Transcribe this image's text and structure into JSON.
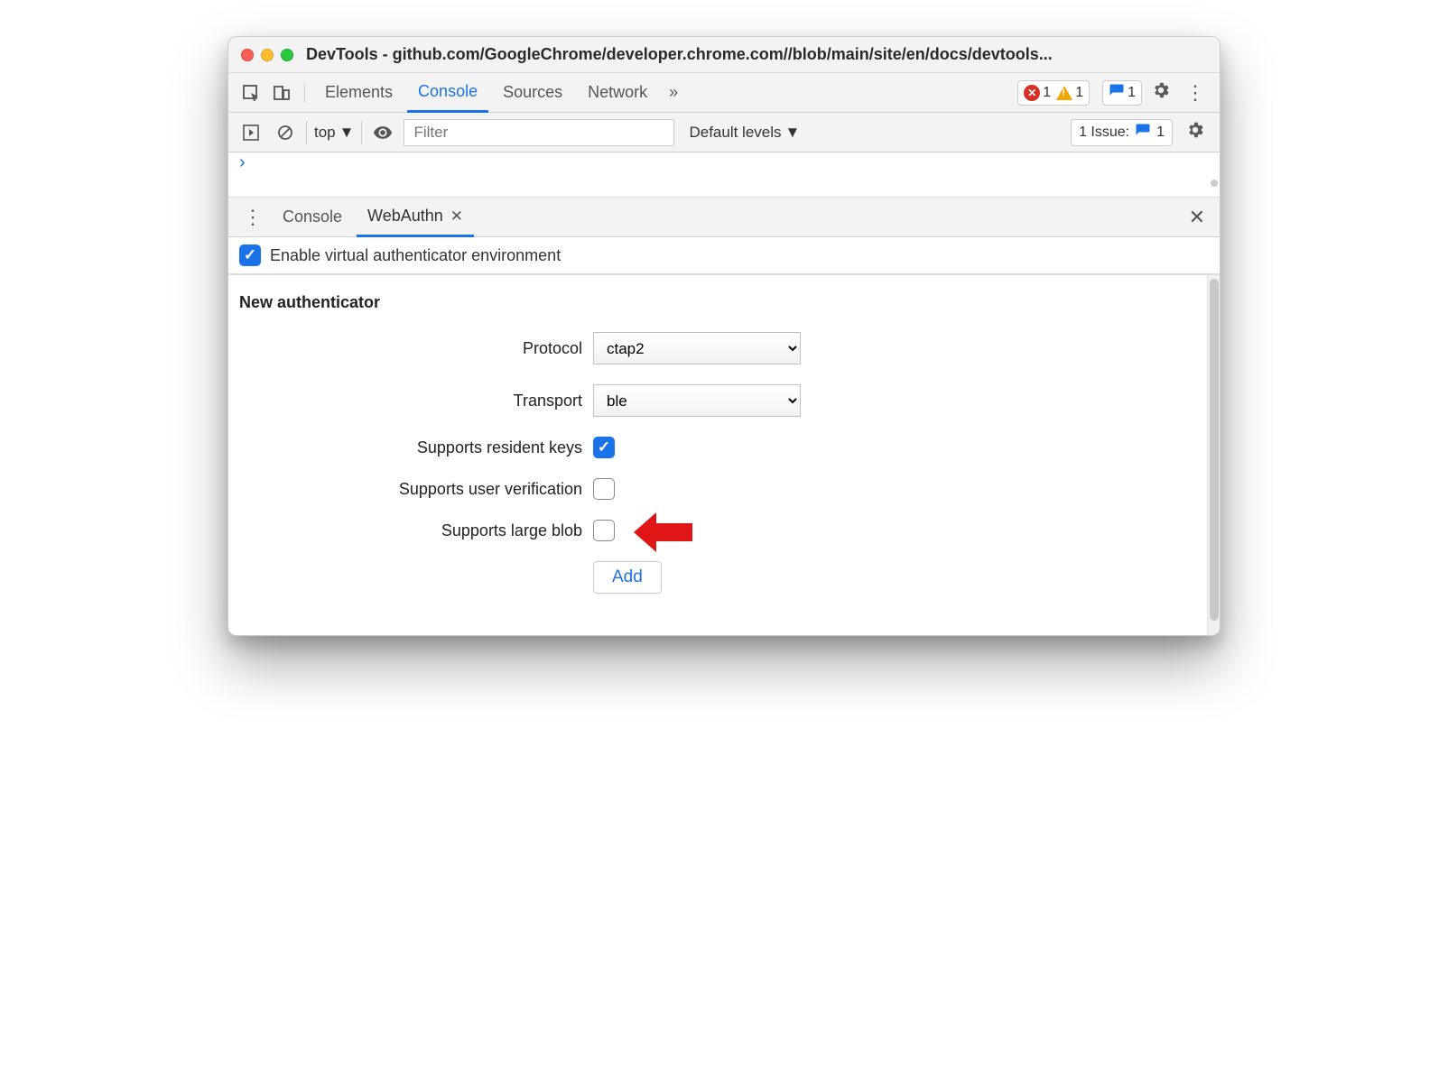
{
  "window": {
    "title": "DevTools - github.com/GoogleChrome/developer.chrome.com//blob/main/site/en/docs/devtools..."
  },
  "main_tabs": {
    "items": [
      "Elements",
      "Console",
      "Sources",
      "Network"
    ],
    "active": "Console"
  },
  "status": {
    "errors": "1",
    "warnings": "1",
    "messages": "1"
  },
  "console_toolbar": {
    "scope": "top",
    "filter_placeholder": "Filter",
    "levels": "Default levels",
    "issues_prefix": "1 Issue:",
    "issues_count": "1"
  },
  "drawer": {
    "tabs": [
      "Console",
      "WebAuthn"
    ],
    "active": "WebAuthn"
  },
  "enable_row": {
    "label": "Enable virtual authenticator environment",
    "checked": true
  },
  "form": {
    "heading": "New authenticator",
    "protocol": {
      "label": "Protocol",
      "value": "ctap2"
    },
    "transport": {
      "label": "Transport",
      "value": "ble"
    },
    "resident_keys": {
      "label": "Supports resident keys",
      "checked": true
    },
    "user_verification": {
      "label": "Supports user verification",
      "checked": false
    },
    "large_blob": {
      "label": "Supports large blob",
      "checked": false
    },
    "add_button": "Add"
  }
}
